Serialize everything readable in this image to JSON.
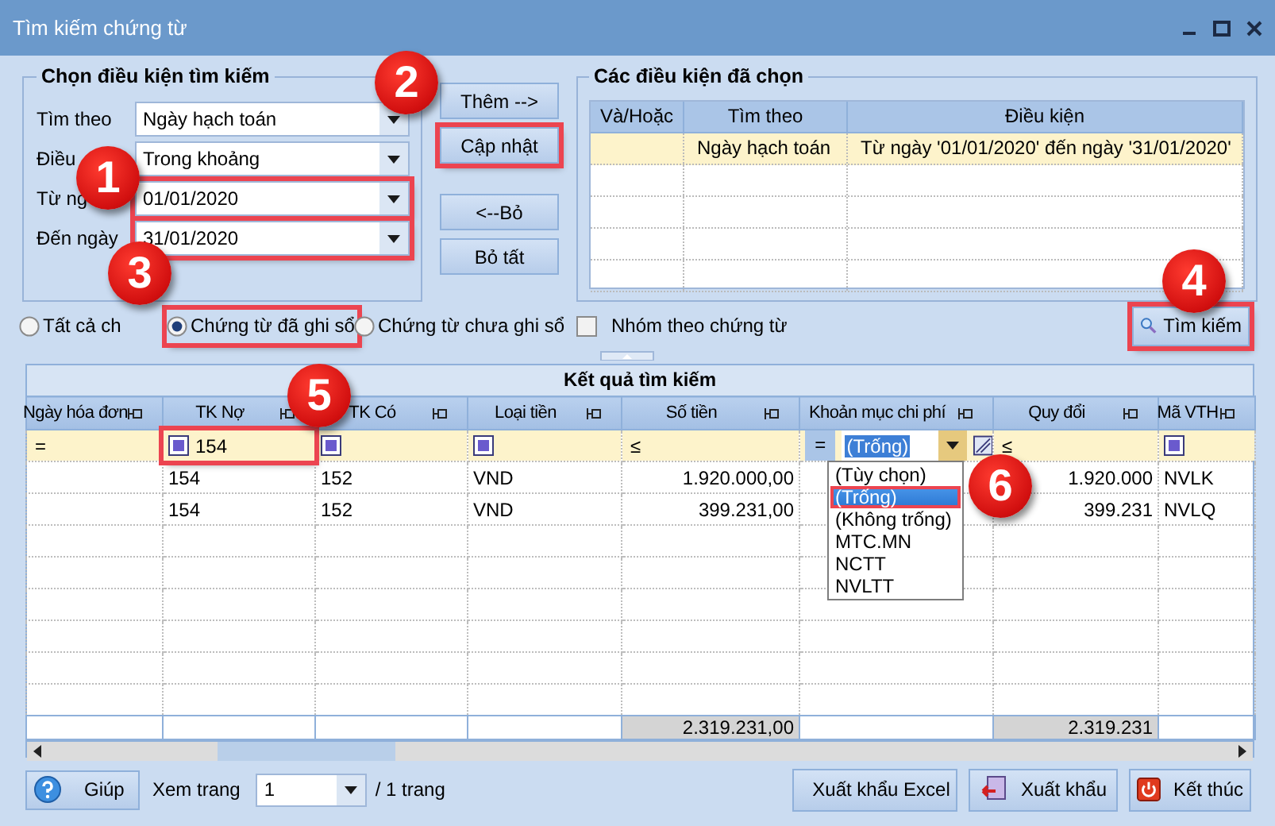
{
  "window": {
    "title": "Tìm kiếm chứng từ"
  },
  "criteria": {
    "title": "Chọn điều kiện tìm kiếm",
    "fields": [
      {
        "label": "Tìm theo",
        "value": "Ngày hạch toán",
        "highlighted": false
      },
      {
        "label": "Điều",
        "value": "Trong khoảng",
        "highlighted": false
      },
      {
        "label": "Từ ng",
        "value": "01/01/2020",
        "highlighted": true
      },
      {
        "label": "Đến ngày",
        "value": "31/01/2020",
        "highlighted": true
      }
    ]
  },
  "criteria_buttons": [
    {
      "label": "Thêm -->",
      "highlighted": false
    },
    {
      "label": "Cập nhật",
      "highlighted": true
    },
    {
      "label": "<--Bỏ",
      "highlighted": false
    },
    {
      "label": "Bỏ tất",
      "highlighted": false
    }
  ],
  "selected_conditions": {
    "title": "Các điều kiện đã chọn",
    "columns": [
      "Và/Hoặc",
      "Tìm theo",
      "Điều kiện"
    ],
    "rows": [
      {
        "search_by": "Ngày hạch toán",
        "condition": "Từ ngày '01/01/2020' đến ngày '31/01/2020'",
        "selected": true
      }
    ]
  },
  "scope": [
    {
      "label": "Tất cả ch",
      "selected": false,
      "highlighted": false
    },
    {
      "label": "Chứng từ đã ghi sổ",
      "selected": true,
      "highlighted": true
    },
    {
      "label": "Chứng từ chưa ghi sổ",
      "selected": false,
      "highlighted": false
    }
  ],
  "group_by_voucher": {
    "label": "Nhóm theo chứng từ",
    "checked": false
  },
  "search_button": {
    "label": "Tìm kiếm",
    "highlighted": true
  },
  "results": {
    "title": "Kết quả tìm kiếm",
    "columns": [
      {
        "label": "Ngày hóa đơn",
        "numeric": false,
        "filter": {
          "kind": "operator",
          "symbol": "=",
          "highlighted": false
        }
      },
      {
        "label": "TK Nợ",
        "numeric": false,
        "filter": {
          "kind": "box",
          "value": "154",
          "highlighted": true
        }
      },
      {
        "label": "TK Có",
        "numeric": false,
        "filter": {
          "kind": "box",
          "highlighted": false
        }
      },
      {
        "label": "Loại tiền",
        "numeric": false,
        "filter": {
          "kind": "box",
          "highlighted": false
        }
      },
      {
        "label": "Số tiền",
        "numeric": true,
        "total": "2.319.231,00",
        "filter": {
          "kind": "operator",
          "symbol": "≤",
          "highlighted": false
        }
      },
      {
        "label": "Khoản mục chi phí",
        "numeric": false,
        "filter": {
          "kind": "combo",
          "symbol": "=",
          "value": "(Trống)",
          "highlighted": false
        }
      },
      {
        "label": "Quy đổi",
        "numeric": true,
        "total": "2.319.231",
        "filter": {
          "kind": "operator",
          "symbol": "≤",
          "highlighted": false
        }
      },
      {
        "label": "Mã VTH",
        "numeric": false,
        "filter": {
          "kind": "box",
          "highlighted": false
        }
      }
    ],
    "rows": [
      [
        null,
        "154",
        "152",
        "VND",
        "1.920.000,00",
        null,
        "1.920.000",
        "NVLK"
      ],
      [
        null,
        "154",
        "152",
        "VND",
        "399.231,00",
        null,
        "399.231",
        "NVLQ"
      ]
    ],
    "dropdown": [
      {
        "label": "(Tùy chọn)",
        "selected": false,
        "highlighted": false
      },
      {
        "label": "(Trống)",
        "selected": true,
        "highlighted": true
      },
      {
        "label": "(Không trống)",
        "selected": false,
        "highlighted": false
      },
      {
        "label": "MTC.MN",
        "selected": false,
        "highlighted": false
      },
      {
        "label": "NCTT",
        "selected": false,
        "highlighted": false
      },
      {
        "label": "NVLTT",
        "selected": false,
        "highlighted": false
      }
    ]
  },
  "footer": {
    "help": "Giúp",
    "page_label": "Xem trang",
    "page": "1",
    "page_total": "/ 1 trang",
    "buttons": [
      {
        "kind": "excel",
        "label": "Xuất khẩu Excel"
      },
      {
        "kind": "export",
        "label": "Xuất khẩu"
      },
      {
        "kind": "exit",
        "label": "Kết thúc"
      }
    ]
  },
  "callouts": [
    {
      "number": "1"
    },
    {
      "number": "2"
    },
    {
      "number": "3"
    },
    {
      "number": "4"
    },
    {
      "number": "5"
    },
    {
      "number": "6"
    }
  ]
}
